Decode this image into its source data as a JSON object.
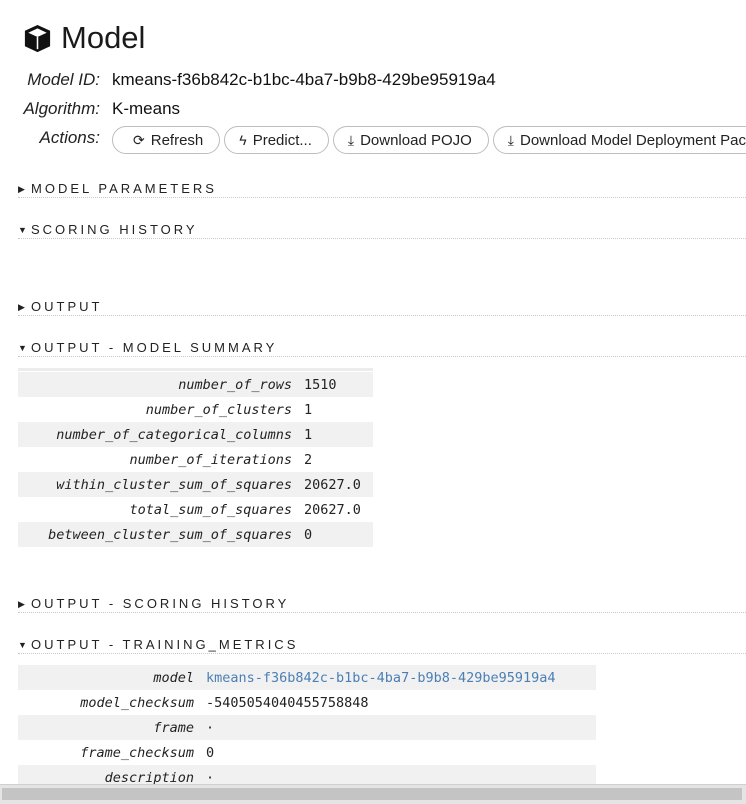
{
  "title": "Model",
  "info": {
    "model_id_label": "Model ID:",
    "model_id": "kmeans-f36b842c-b1bc-4ba7-b9b8-429be95919a4",
    "algorithm_label": "Algorithm:",
    "algorithm": "K-means",
    "actions_label": "Actions:"
  },
  "actions": {
    "refresh": "Refresh",
    "predict": "Predict...",
    "download_pojo": "Download POJO",
    "download_deployment": "Download Model Deployment Package (MOJO)"
  },
  "sections": {
    "model_parameters": "MODEL PARAMETERS",
    "scoring_history": "SCORING HISTORY",
    "output": "OUTPUT",
    "output_model_summary": "OUTPUT - MODEL SUMMARY",
    "output_scoring_history": "OUTPUT - SCORING HISTORY",
    "output_training_metrics": "OUTPUT - TRAINING_METRICS"
  },
  "model_summary": [
    {
      "key": "number_of_rows",
      "value": "1510"
    },
    {
      "key": "number_of_clusters",
      "value": "1"
    },
    {
      "key": "number_of_categorical_columns",
      "value": "1"
    },
    {
      "key": "number_of_iterations",
      "value": "2"
    },
    {
      "key": "within_cluster_sum_of_squares",
      "value": "20627.0"
    },
    {
      "key": "total_sum_of_squares",
      "value": "20627.0"
    },
    {
      "key": "between_cluster_sum_of_squares",
      "value": "0"
    }
  ],
  "training_metrics": [
    {
      "key": "model",
      "value": "kmeans-f36b842c-b1bc-4ba7-b9b8-429be95919a4"
    },
    {
      "key": "model_checksum",
      "value": "-5405054040455758848"
    },
    {
      "key": "frame",
      "value": "·"
    },
    {
      "key": "frame_checksum",
      "value": "0"
    },
    {
      "key": "description",
      "value": "·"
    }
  ],
  "icons": {
    "title": "cube-icon",
    "refresh": "refresh-icon",
    "predict": "bolt-icon",
    "download": "download-icon",
    "expanded": "caret-down-icon",
    "collapsed": "caret-right-icon"
  },
  "colors": {
    "link": "#4a7fb5",
    "row_stripe": "#f1f1f1"
  }
}
